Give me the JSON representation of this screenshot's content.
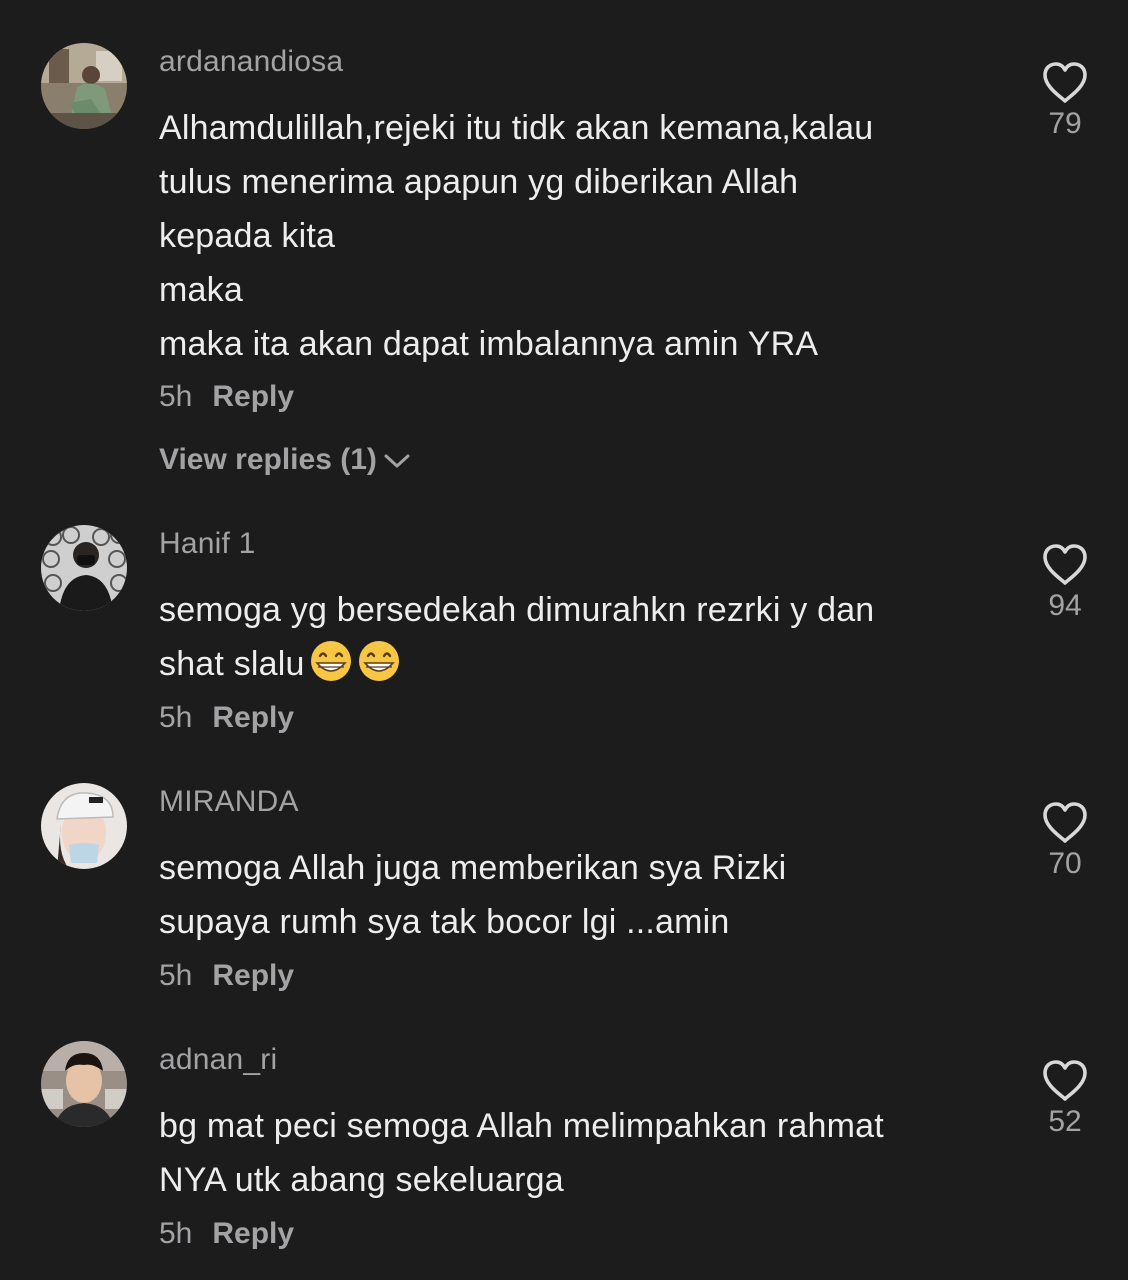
{
  "comments": [
    {
      "username": "ardanandiosa",
      "lines": [
        "Alhamdulillah,rejeki itu tidk akan kemana,kalau",
        "tulus menerima apapun yg diberikan Allah",
        "kepada kita",
        "maka",
        "maka ita akan dapat imbalannya amin YRA"
      ],
      "time": "5h",
      "reply_label": "Reply",
      "likes": "79",
      "view_replies": "View replies (1)"
    },
    {
      "username": "Hanif 1",
      "lines": [
        "semoga yg bersedekah dimurahkn rezrki y dan",
        "shat slalu"
      ],
      "time": "5h",
      "reply_label": "Reply",
      "likes": "94"
    },
    {
      "username": "MIRANDA",
      "lines": [
        "semoga Allah juga memberikan sya Rizki",
        "supaya rumh sya tak bocor lgi ...amin"
      ],
      "time": "5h",
      "reply_label": "Reply",
      "likes": "70"
    },
    {
      "username": "adnan_ri",
      "lines": [
        "bg mat peci semoga Allah melimpahkan rahmat",
        "NYA utk abang sekeluarga"
      ],
      "time": "5h",
      "reply_label": "Reply",
      "likes": "52"
    }
  ],
  "icons": {
    "like": "heart-outline-icon",
    "emoji": "grinning-face-emoji",
    "expand": "chevron-down-icon"
  },
  "colors": {
    "background": "#1c1c1d",
    "primary_text": "#ededed",
    "secondary_text": "#a3a3a5",
    "icon": "#d8d8d8"
  }
}
